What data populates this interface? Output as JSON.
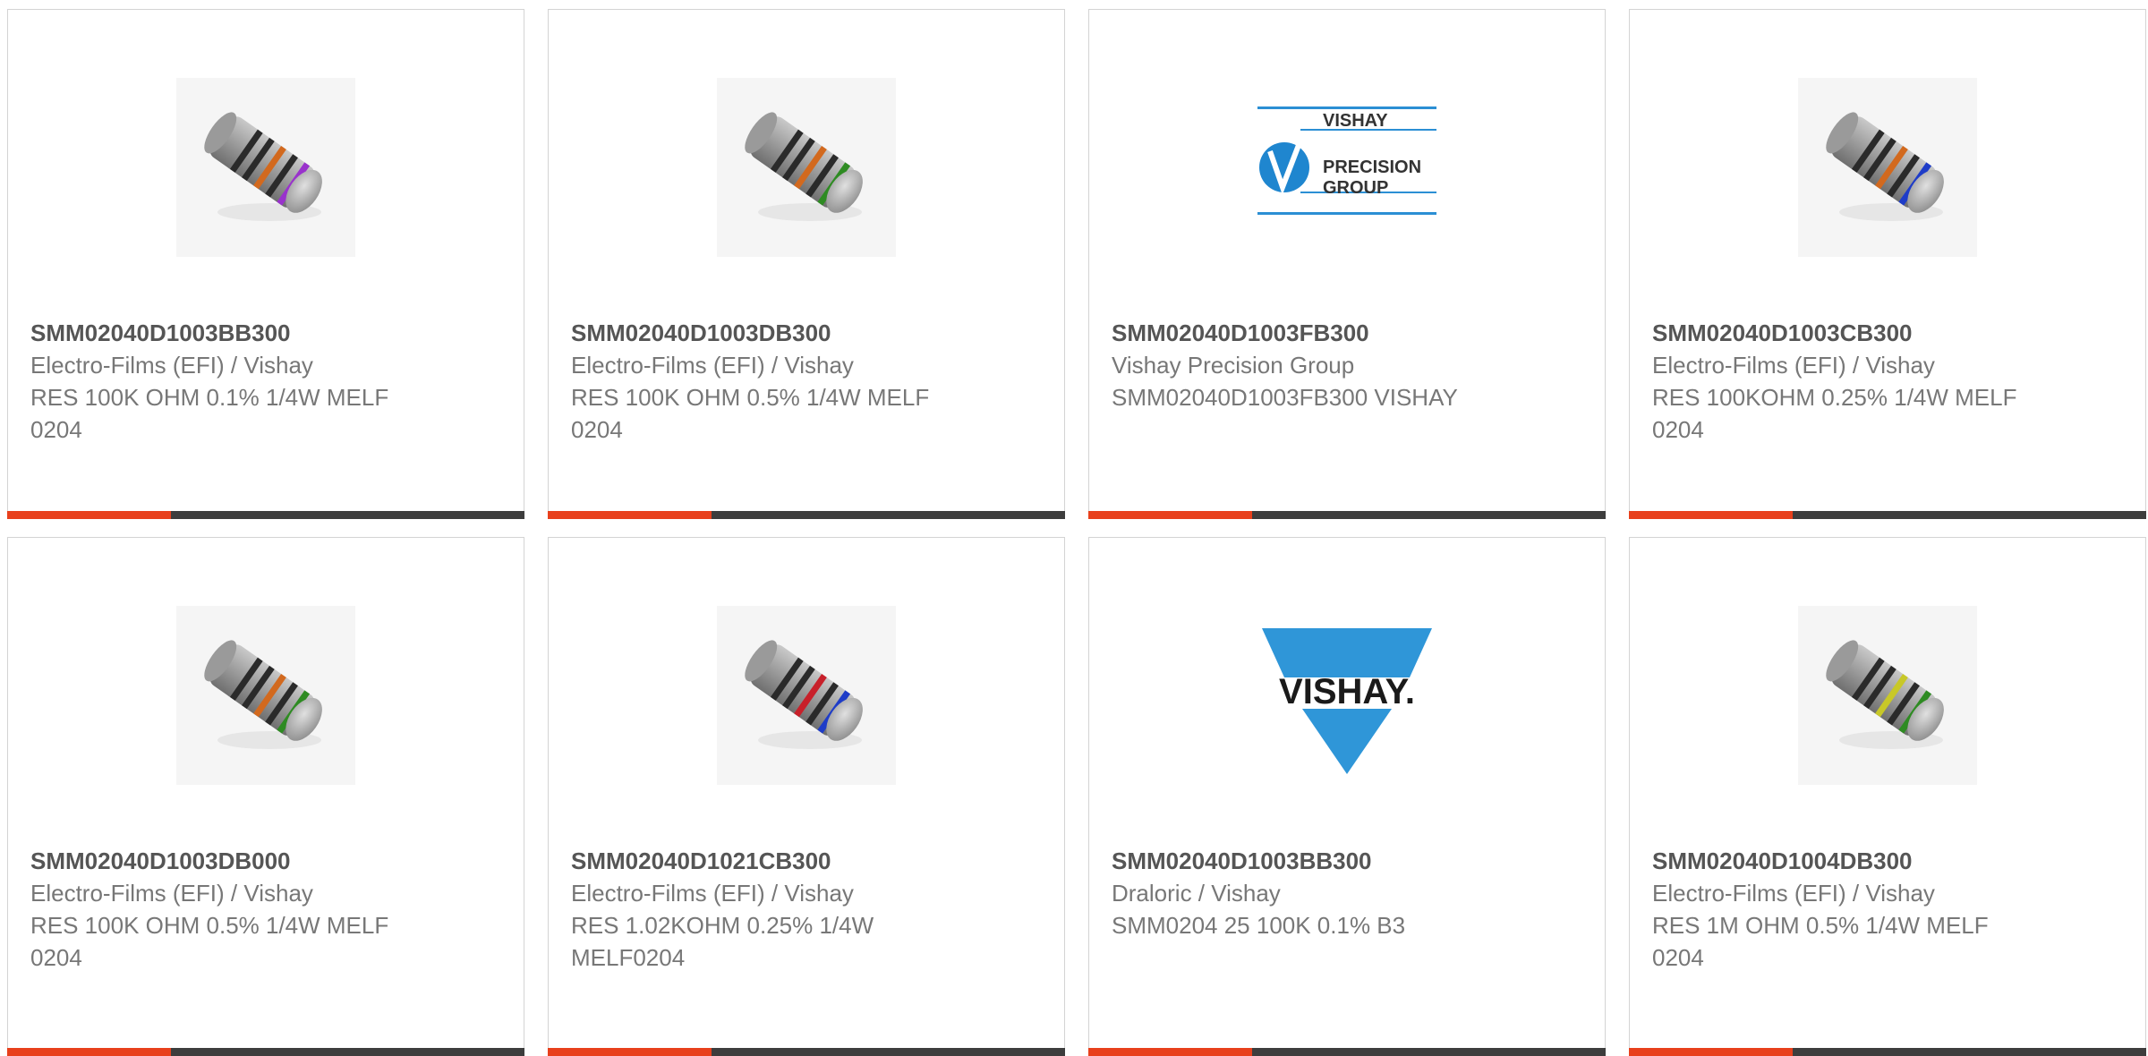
{
  "colors": {
    "accent": "#e8401c",
    "bar": "#3d3d3d",
    "vishay_blue": "#2b8fd4"
  },
  "products": [
    {
      "part_number": "SMM02040D1003BB300",
      "manufacturer": "Electro-Films (EFI) / Vishay",
      "description": "RES 100K OHM 0.1% 1/4W MELF 0204",
      "image": "resistor-melf",
      "band_colors": [
        "#2a2a2a",
        "#2a2a2a",
        "#d2691e",
        "#2a2a2a",
        "#9932cc"
      ]
    },
    {
      "part_number": "SMM02040D1003DB300",
      "manufacturer": "Electro-Films (EFI) / Vishay",
      "description": "RES 100K OHM 0.5% 1/4W MELF 0204",
      "image": "resistor-melf",
      "band_colors": [
        "#2a2a2a",
        "#2a2a2a",
        "#d2691e",
        "#2a2a2a",
        "#2e8b22"
      ]
    },
    {
      "part_number": "SMM02040D1003FB300",
      "manufacturer": "Vishay Precision Group",
      "description": "SMM02040D1003FB300 VISHAY",
      "image": "vishay-precision-group-logo",
      "logo_text": [
        "VISHAY",
        "PRECISION",
        "GROUP"
      ]
    },
    {
      "part_number": "SMM02040D1003CB300",
      "manufacturer": "Electro-Films (EFI) / Vishay",
      "description": "RES 100KOHM 0.25% 1/4W MELF 0204",
      "image": "resistor-melf",
      "band_colors": [
        "#2a2a2a",
        "#2a2a2a",
        "#d2691e",
        "#2a2a2a",
        "#1e3cc8"
      ]
    },
    {
      "part_number": "SMM02040D1003DB000",
      "manufacturer": "Electro-Films (EFI) / Vishay",
      "description": "RES 100K OHM 0.5% 1/4W MELF 0204",
      "image": "resistor-melf",
      "band_colors": [
        "#2a2a2a",
        "#2a2a2a",
        "#d2691e",
        "#2a2a2a",
        "#2e8b22"
      ]
    },
    {
      "part_number": "SMM02040D1021CB300",
      "manufacturer": "Electro-Films (EFI) / Vishay",
      "description": "RES 1.02KOHM 0.25% 1/4W MELF0204",
      "image": "resistor-melf",
      "band_colors": [
        "#2a2a2a",
        "#2a2a2a",
        "#c8202a",
        "#2a2a2a",
        "#1e3cc8"
      ]
    },
    {
      "part_number": "SMM02040D1003BB300",
      "manufacturer": "Draloric / Vishay",
      "description": "SMM0204 25 100K 0.1% B3",
      "image": "vishay-logo",
      "logo_text": [
        "VISHAY."
      ]
    },
    {
      "part_number": "SMM02040D1004DB300",
      "manufacturer": "Electro-Films (EFI) / Vishay",
      "description": "RES 1M OHM 0.5% 1/4W MELF 0204",
      "image": "resistor-melf",
      "band_colors": [
        "#2a2a2a",
        "#2a2a2a",
        "#c8c828",
        "#2a2a2a",
        "#2e8b22"
      ]
    }
  ]
}
